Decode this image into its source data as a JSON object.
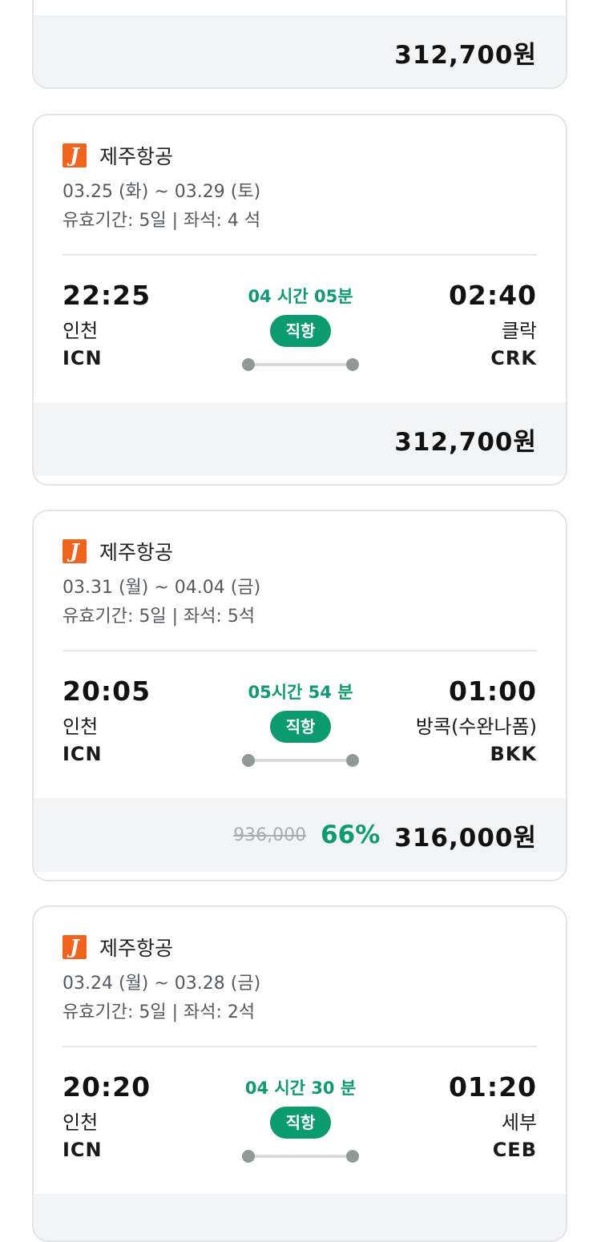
{
  "top_card": {
    "price": "312,700원"
  },
  "cards": [
    {
      "airline": "제주항공",
      "logo_letter": "J",
      "dates": "03.25 (화) ~ 03.29 (토)",
      "validity": "유효기간: 5일 | 좌석: 4 석",
      "departure": {
        "time": "22:25",
        "city": "인천",
        "code": "ICN"
      },
      "duration": "04 시간 05분",
      "direct_label": "직항",
      "arrival": {
        "time": "02:40",
        "city": "클락",
        "code": "CRK"
      },
      "price": "312,700원"
    },
    {
      "airline": "제주항공",
      "logo_letter": "J",
      "dates": "03.31 (월) ~ 04.04 (금)",
      "validity": "유효기간: 5일 | 좌석: 5석",
      "departure": {
        "time": "20:05",
        "city": "인천",
        "code": "ICN"
      },
      "duration": "05시간 54 분",
      "direct_label": "직항",
      "arrival": {
        "time": "01:00",
        "city": "방콕(수완나폼)",
        "code": "BKK"
      },
      "original_price": "936,000",
      "discount": "66%",
      "price": "316,000원"
    },
    {
      "airline": "제주항공",
      "logo_letter": "J",
      "dates": "03.24 (월) ~ 03.28 (금)",
      "validity": "유효기간: 5일 | 좌석: 2석",
      "departure": {
        "time": "20:20",
        "city": "인천",
        "code": "ICN"
      },
      "duration": "04 시간 30 분",
      "direct_label": "직항",
      "arrival": {
        "time": "01:20",
        "city": "세부",
        "code": "CEB"
      }
    }
  ],
  "colors": {
    "accent_green": "#0e9a72",
    "logo_orange": "#f0641e",
    "price_bar_bg": "#f3f4f5"
  }
}
